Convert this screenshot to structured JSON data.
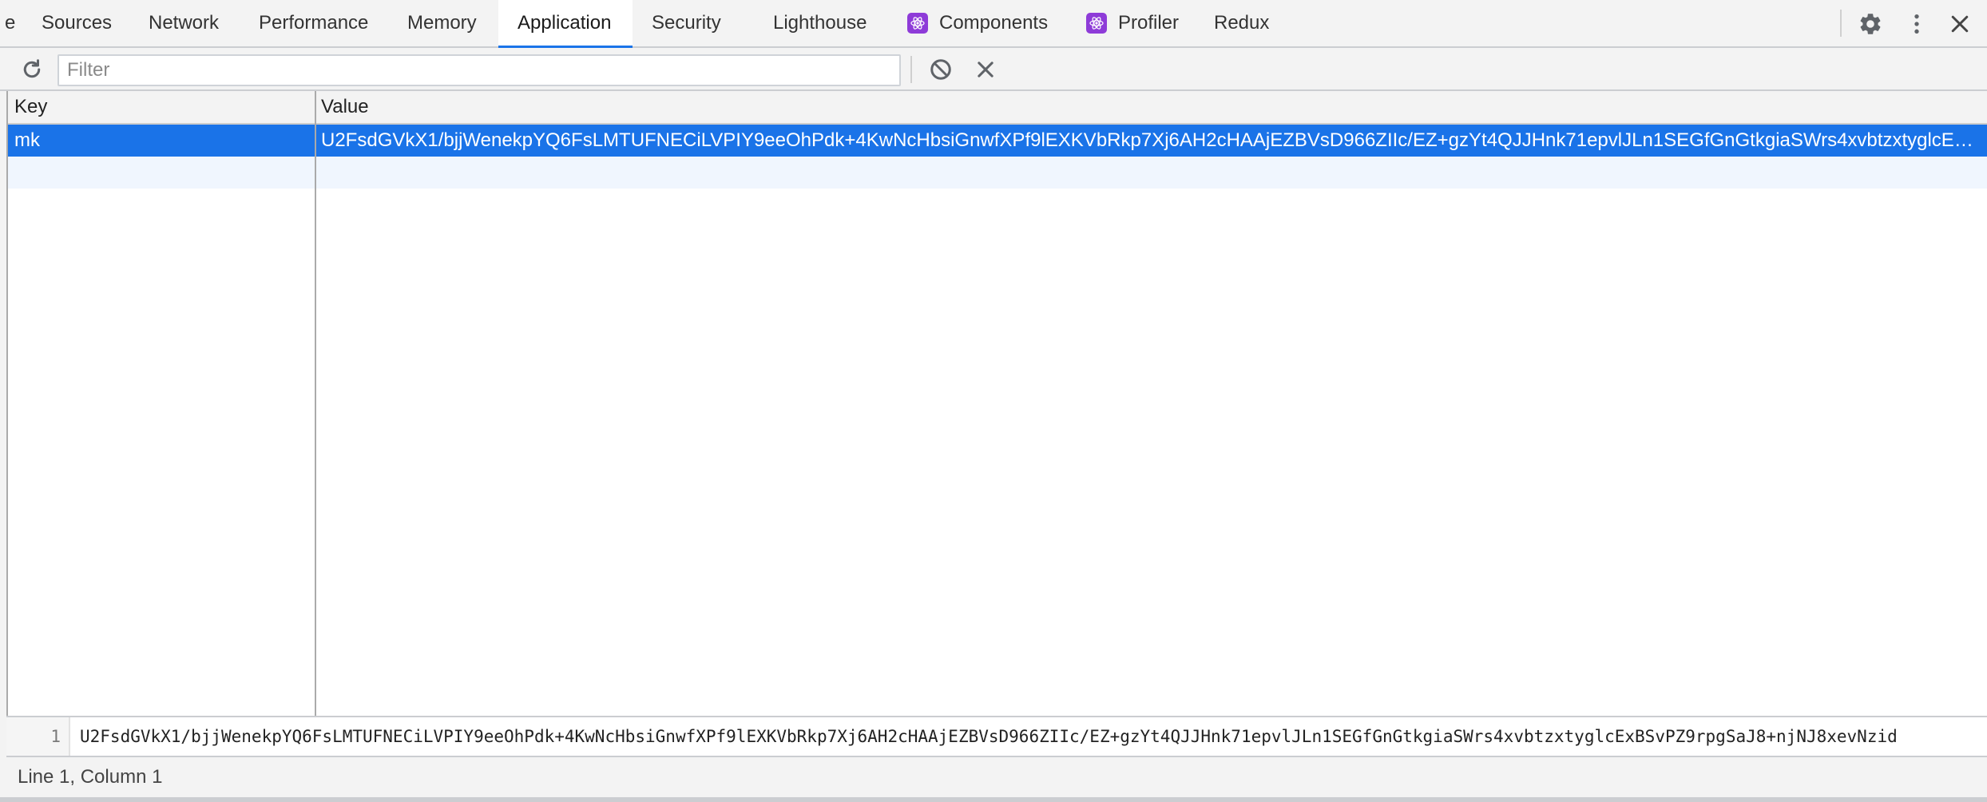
{
  "tabs": {
    "partial": "e",
    "sources": "Sources",
    "network": "Network",
    "performance": "Performance",
    "memory": "Memory",
    "application": "Application",
    "security": "Security",
    "lighthouse": "Lighthouse",
    "components": "Components",
    "profiler": "Profiler",
    "redux": "Redux"
  },
  "toolbar": {
    "filter_placeholder": "Filter",
    "filter_value": ""
  },
  "grid": {
    "headers": {
      "key": "Key",
      "value": "Value"
    },
    "rows": [
      {
        "key": "mk",
        "value": "U2FsdGVkX1/bjjWenekpYQ6FsLMTUFNECiLVPIY9eeOhPdk+4KwNcHbsiGnwfXPf9lEXKVbRkp7Xj6AH2cHAAjEZBVsD966ZIIc/EZ+gzYt4QJJHnk71epvlJLn1SEGfGnGtkgiaSWrs4xvbtzxtyglcEx…"
      }
    ]
  },
  "preview": {
    "line_number": "1",
    "text": "U2FsdGVkX1/bjjWenekpYQ6FsLMTUFNECiLVPIY9eeOhPdk+4KwNcHbsiGnwfXPf9lEXKVbRkp7Xj6AH2cHAAjEZBVsD966ZIIc/EZ+gzYt4QJJHnk71epvlJLn1SEGfGnGtkgiaSWrs4xvbtzxtyglcExBSvPZ9rpgSaJ8+njNJ8xevNzid"
  },
  "status": {
    "position": "Line 1, Column 1"
  },
  "colors": {
    "selection": "#1a73e8",
    "react_badge": "#8e3bd8",
    "panel_bg": "#f3f3f3"
  }
}
